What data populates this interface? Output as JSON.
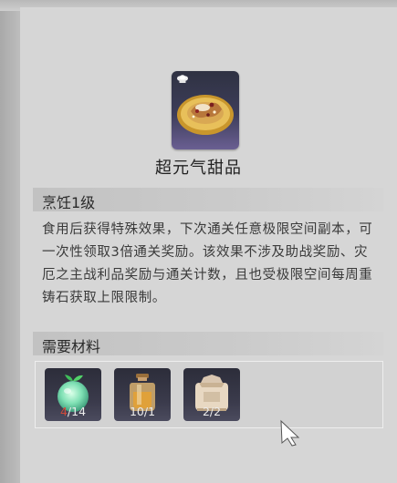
{
  "item": {
    "name": "超元气甜品",
    "icon": "dessert-plate-icon"
  },
  "cooking": {
    "level_label": "烹饪1级",
    "description": "食用后获得特殊效果，下次通关任意极限空间副本，可一次性领取3倍通关奖励。该效果不涉及助战奖励、灾厄之主战利品奖励与通关计数，且也受极限空间每周重铸石获取上限限制。"
  },
  "materials": {
    "header": "需要材料",
    "items": [
      {
        "icon": "green-fruit-icon",
        "have": "4",
        "need": "14",
        "lacking": true
      },
      {
        "icon": "honey-jar-icon",
        "have": "10",
        "need": "1",
        "lacking": false
      },
      {
        "icon": "flour-sack-icon",
        "have": "2",
        "need": "2",
        "lacking": false
      }
    ]
  },
  "colors": {
    "lacking_count": "#d04a3a",
    "card_gradient_bottom": "#6a5f92"
  }
}
